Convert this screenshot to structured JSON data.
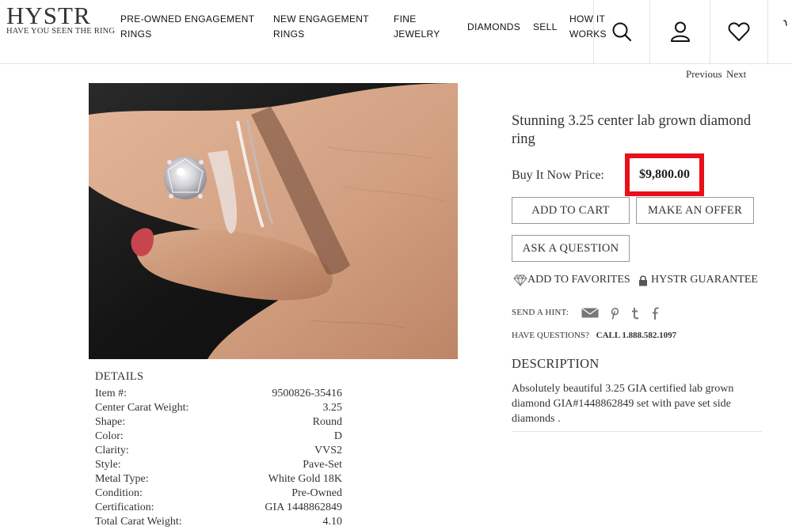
{
  "logo": {
    "main": "HYSTR",
    "tagline": "HAVE YOU SEEN THE RING"
  },
  "nav": [
    "PRE-OWNED ENGAGEMENT RINGS",
    "NEW ENGAGEMENT RINGS",
    "FINE JEWELRY",
    "DIAMONDS",
    "SELL",
    "HOW IT WORKS"
  ],
  "icons": [
    "search-icon",
    "account-icon",
    "heart-icon",
    "cart-icon"
  ],
  "pager": {
    "previous": "Previous",
    "next": "Next"
  },
  "product": {
    "title": "Stunning 3.25 center lab grown diamond ring",
    "price_label": "Buy It Now Price:",
    "price": "$9,800.00",
    "highlight_color": "#e8101a"
  },
  "actions": {
    "add_to_cart": "ADD TO CART",
    "make_offer": "MAKE AN OFFER",
    "ask_question": "ASK A QUESTION",
    "add_to_favorites": "ADD TO FAVORITES",
    "guarantee": "HYSTR GUARANTEE"
  },
  "share": {
    "label": "SEND A HINT:",
    "icons": [
      "email-icon",
      "pinterest-icon",
      "tumblr-icon",
      "facebook-icon"
    ]
  },
  "contact": {
    "label": "HAVE QUESTIONS?",
    "phone": "CALL 1.888.582.1097"
  },
  "description": {
    "title": "DESCRIPTION",
    "text": "Absolutely beautiful 3.25 GIA certified lab grown diamond GIA#1448862849 set with pave set side diamonds ."
  },
  "details": {
    "title": "DETAILS",
    "rows": [
      {
        "label": "Item #:",
        "value": "9500826-35416"
      },
      {
        "label": "Center Carat Weight:",
        "value": "3.25"
      },
      {
        "label": "Shape:",
        "value": "Round"
      },
      {
        "label": "Color:",
        "value": "D"
      },
      {
        "label": "Clarity:",
        "value": "VVS2"
      },
      {
        "label": "Style:",
        "value": "Pave-Set"
      },
      {
        "label": "Metal Type:",
        "value": "White Gold 18K"
      },
      {
        "label": "Condition:",
        "value": "Pre-Owned"
      },
      {
        "label": "Certification:",
        "value": "GIA 1448862849"
      },
      {
        "label": "Total Carat Weight:",
        "value": "4.10"
      }
    ]
  }
}
